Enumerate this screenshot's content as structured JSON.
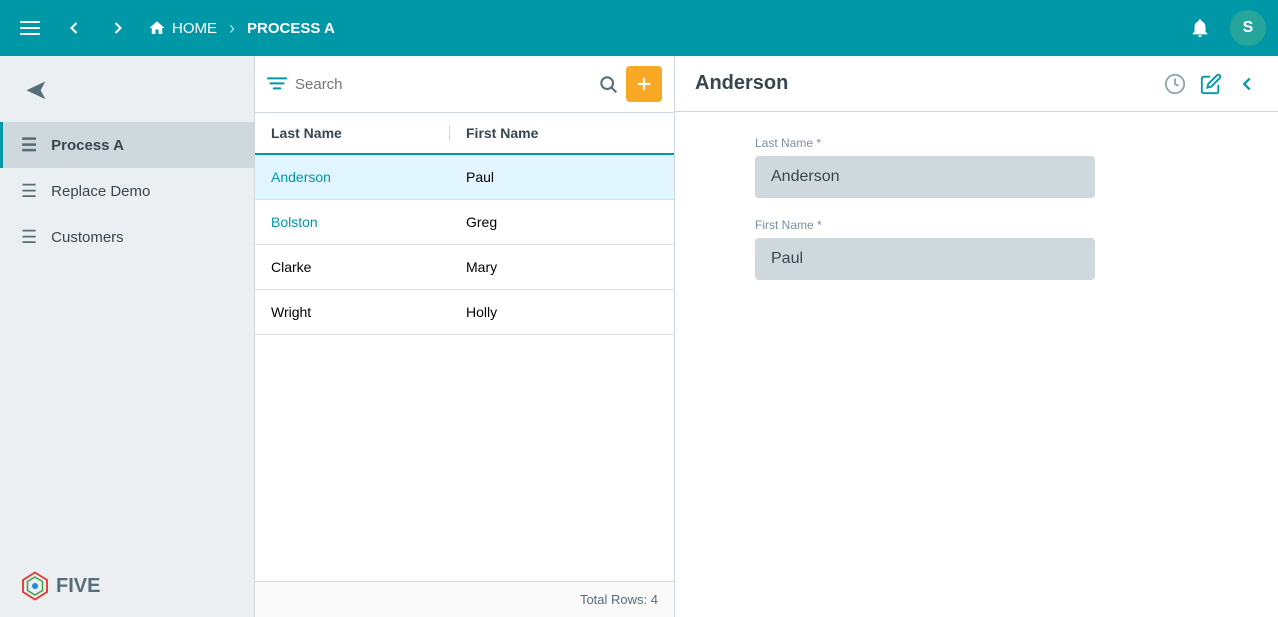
{
  "nav": {
    "home_label": "HOME",
    "process_label": "PROCESS A",
    "avatar_initial": "S"
  },
  "sidebar": {
    "share_icon": "➤",
    "items": [
      {
        "label": "Process A",
        "active": true
      },
      {
        "label": "Replace Demo",
        "active": false
      },
      {
        "label": "Customers",
        "active": false
      }
    ]
  },
  "search": {
    "placeholder": "Search"
  },
  "table": {
    "col_last": "Last Name",
    "col_first": "First Name",
    "rows": [
      {
        "last": "Anderson",
        "first": "Paul",
        "selected": true,
        "link": true
      },
      {
        "last": "Bolston",
        "first": "Greg",
        "selected": false,
        "link": true
      },
      {
        "last": "Clarke",
        "first": "Mary",
        "selected": false,
        "link": false
      },
      {
        "last": "Wright",
        "first": "Holly",
        "selected": false,
        "link": false
      }
    ],
    "footer": "Total Rows: 4"
  },
  "detail": {
    "title": "Anderson",
    "fields": [
      {
        "label": "Last Name *",
        "value": "Anderson"
      },
      {
        "label": "First Name *",
        "value": "Paul"
      }
    ]
  },
  "logo": {
    "text": "FIVE"
  }
}
